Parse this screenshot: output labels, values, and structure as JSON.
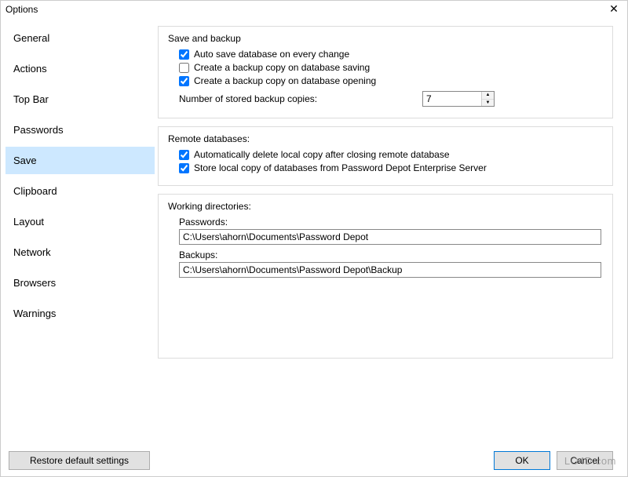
{
  "window": {
    "title": "Options"
  },
  "sidebar": {
    "items": [
      {
        "label": "General"
      },
      {
        "label": "Actions"
      },
      {
        "label": "Top Bar"
      },
      {
        "label": "Passwords"
      },
      {
        "label": "Save"
      },
      {
        "label": "Clipboard"
      },
      {
        "label": "Layout"
      },
      {
        "label": "Network"
      },
      {
        "label": "Browsers"
      },
      {
        "label": "Warnings"
      }
    ],
    "selected_index": 4
  },
  "sections": {
    "save_backup": {
      "title": "Save and backup",
      "auto_save": {
        "label": "Auto save database on every change",
        "checked": true
      },
      "backup_on_save": {
        "label": "Create a backup copy on database saving",
        "checked": false
      },
      "backup_on_open": {
        "label": "Create a backup copy on database opening",
        "checked": true
      },
      "num_backups": {
        "label": "Number of stored backup copies:",
        "value": "7"
      }
    },
    "remote": {
      "title": "Remote databases:",
      "auto_delete": {
        "label": "Automatically delete local copy after closing remote database",
        "checked": true
      },
      "store_local": {
        "label": "Store local copy of databases from Password Depot Enterprise Server",
        "checked": true
      }
    },
    "working_dirs": {
      "title": "Working directories:",
      "passwords": {
        "label": "Passwords:",
        "value": "C:\\Users\\ahorn\\Documents\\Password Depot"
      },
      "backups": {
        "label": "Backups:",
        "value": "C:\\Users\\ahorn\\Documents\\Password Depot\\Backup"
      }
    }
  },
  "footer": {
    "restore": "Restore default settings",
    "ok": "OK",
    "cancel": "Cancel"
  },
  "watermark": "LO4D.com"
}
